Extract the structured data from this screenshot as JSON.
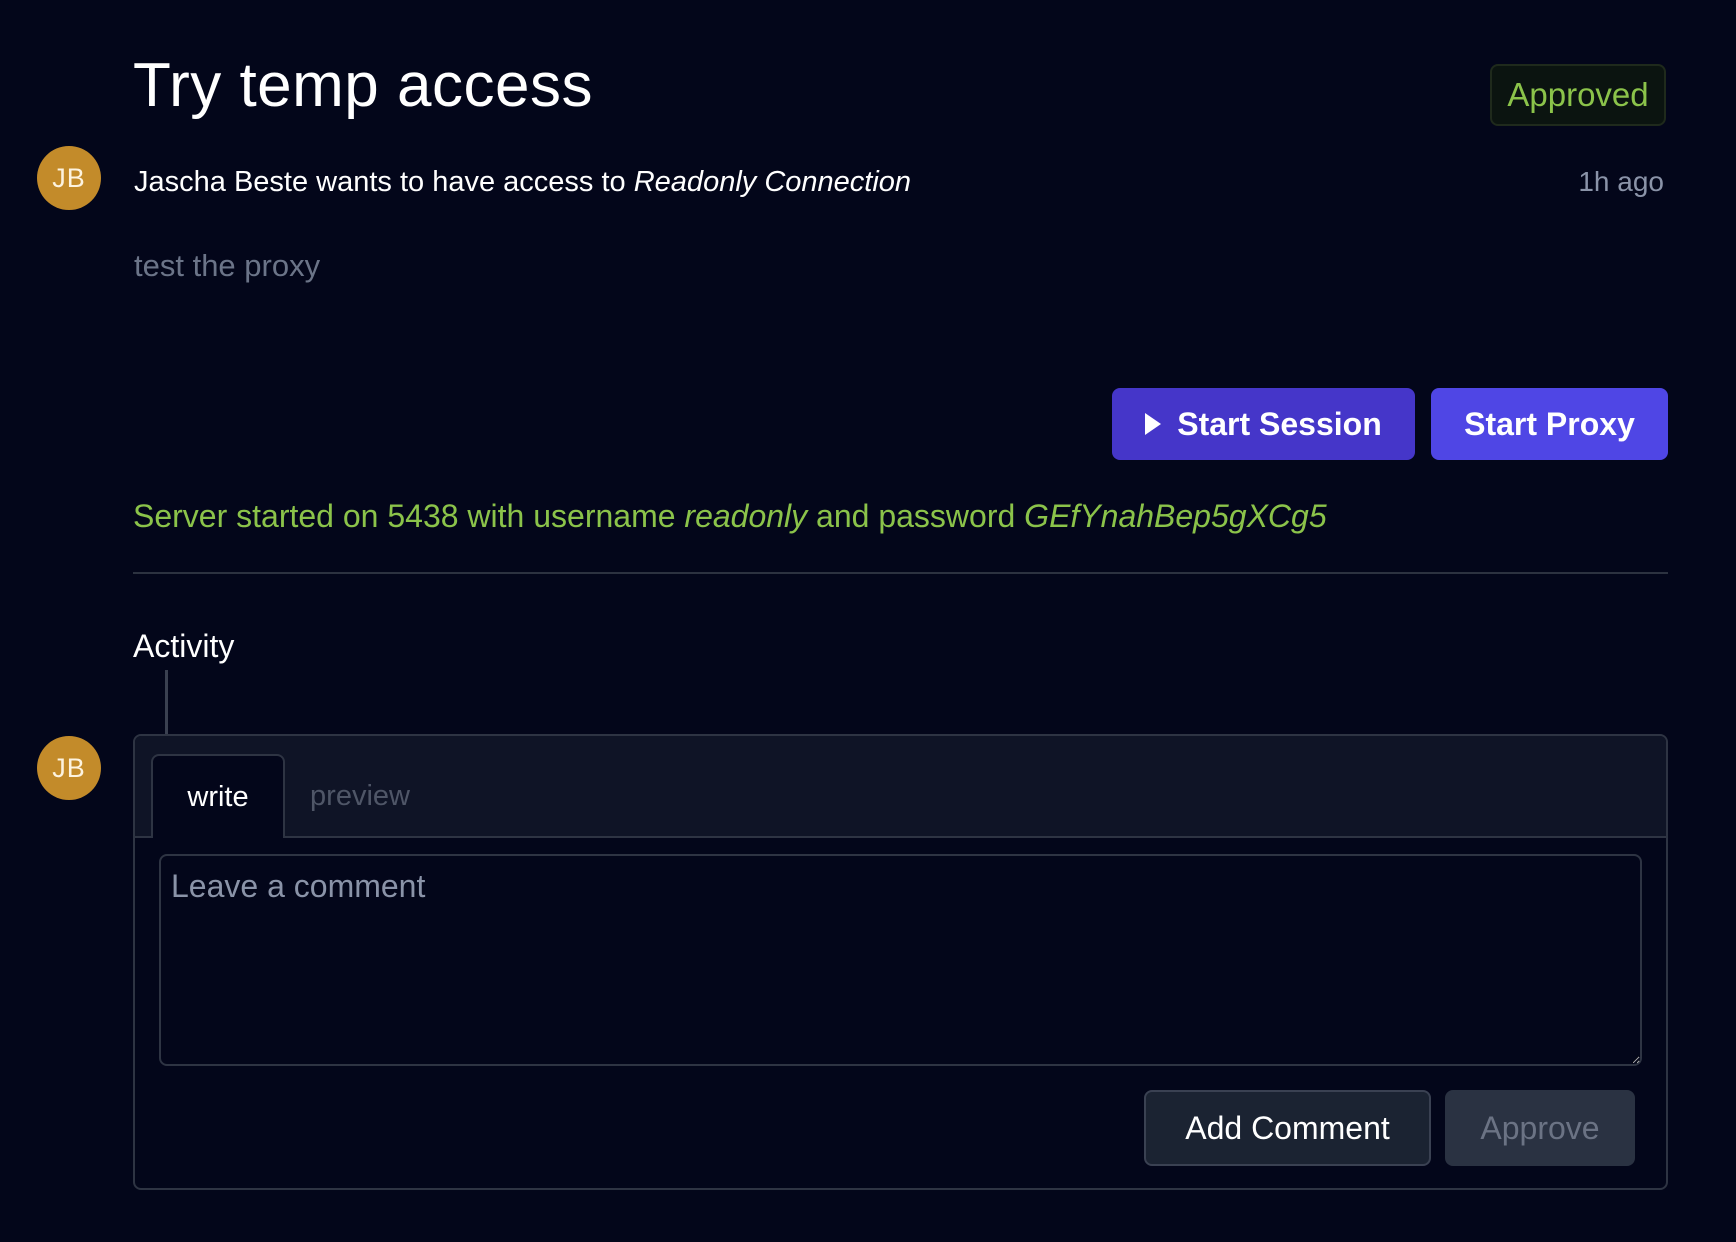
{
  "request": {
    "title": "Try temp access",
    "status": "Approved",
    "requester_initials": "JB",
    "requester_name": "Jascha Beste",
    "access_text": "wants to have access to",
    "connection_name": "Readonly Connection",
    "time_ago": "1h ago",
    "description": "test the proxy"
  },
  "actions": {
    "start_session_label": "Start Session",
    "start_proxy_label": "Start Proxy"
  },
  "server": {
    "prefix": "Server started on",
    "port": "5438",
    "username_text": "with username",
    "username": "readonly",
    "password_text": "and password",
    "password": "GEfYnahBep5gXCg5"
  },
  "activity": {
    "heading": "Activity",
    "avatar_initials": "JB",
    "tabs": {
      "write": "write",
      "preview": "preview"
    },
    "comment_placeholder": "Leave a comment",
    "add_comment_label": "Add Comment",
    "approve_label": "Approve"
  },
  "colors": {
    "background": "#03061a",
    "success": "#8bc34a",
    "primary": "#4f46e5",
    "avatar": "#c38b2a"
  }
}
